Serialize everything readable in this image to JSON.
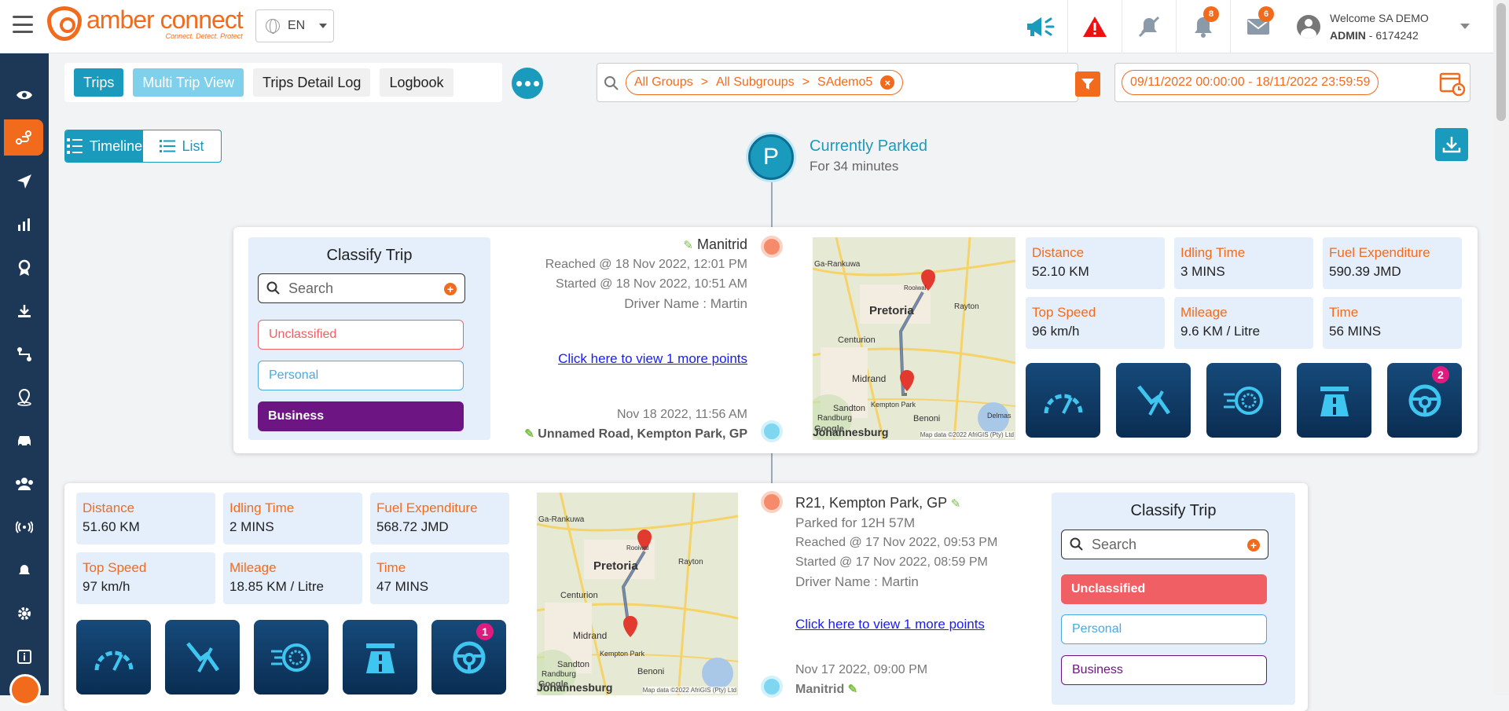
{
  "header": {
    "logo_name": "amber connect",
    "logo_tagline": "Connect. Detect. Protect",
    "language": "EN",
    "notifications_count": "8",
    "messages_count": "6",
    "welcome": "Welcome SA DEMO",
    "account_role": "ADMIN",
    "account_id": " - 6174242"
  },
  "tabs": [
    {
      "label": "Trips"
    },
    {
      "label": "Multi Trip View"
    },
    {
      "label": "Trips Detail Log"
    },
    {
      "label": "Logbook"
    }
  ],
  "filter": {
    "groups": "All Groups",
    "subgroups": "All Subgroups",
    "vehicle": "SAdemo5",
    "separator": ">",
    "date_range": "09/11/2022 00:00:00 - 18/11/2022 23:59:59"
  },
  "view_toggle": {
    "timeline": "Timeline",
    "list": "List"
  },
  "current_status": {
    "icon_letter": "P",
    "title": "Currently Parked",
    "duration": "For 34 minutes"
  },
  "classify": {
    "title": "Classify Trip",
    "search_placeholder": "Search",
    "options": [
      "Unclassified",
      "Personal",
      "Business"
    ]
  },
  "trips": [
    {
      "end_location": "Manitrid",
      "reached": "Reached @ 18 Nov 2022, 12:01 PM",
      "started": "Started @ 18 Nov 2022, 10:51 AM",
      "driver": "Driver Name : Martin",
      "more_points_link": "Click here to view 1 more points",
      "start_time": "Nov 18 2022, 11:56 AM",
      "start_location": "Unnamed Road, Kempton Park, GP",
      "selected_class": "Business",
      "stats": [
        {
          "label": "Distance",
          "value": "52.10 KM"
        },
        {
          "label": "Idling Time",
          "value": "3 MINS"
        },
        {
          "label": "Fuel Expenditure",
          "value": "590.39 JMD"
        },
        {
          "label": "Top Speed",
          "value": "96 km/h"
        },
        {
          "label": "Mileage",
          "value": "9.6 KM / Litre"
        },
        {
          "label": "Time",
          "value": "56 MINS"
        }
      ],
      "driving_alerts_badge": "2"
    },
    {
      "end_location": "R21, Kempton Park, GP",
      "parked": "Parked for 12H 57M",
      "reached": "Reached @ 17 Nov 2022, 09:53 PM",
      "started": "Started @ 17 Nov 2022, 08:59 PM",
      "driver": "Driver Name : Martin",
      "more_points_link": "Click here to view 1 more points",
      "start_time": "Nov 17 2022, 09:00 PM",
      "start_location": "Manitrid",
      "selected_class": "Unclassified",
      "stats": [
        {
          "label": "Distance",
          "value": "51.60 KM"
        },
        {
          "label": "Idling Time",
          "value": "2 MINS"
        },
        {
          "label": "Fuel Expenditure",
          "value": "568.72 JMD"
        },
        {
          "label": "Top Speed",
          "value": "97 km/h"
        },
        {
          "label": "Mileage",
          "value": "18.85 KM / Litre"
        },
        {
          "label": "Time",
          "value": "47 MINS"
        }
      ],
      "driving_alerts_badge": "1"
    }
  ],
  "map": {
    "labels": [
      "Ga-Rankuwa",
      "Pretoria",
      "Rayton",
      "Centurion",
      "Midrand",
      "Kempton Park",
      "Sandton",
      "Randburg",
      "Benoni",
      "Delmas",
      "Johannesburg",
      "Rooiwal"
    ],
    "attribution": "Map data ©2022 AfriGIS (Pty) Ltd",
    "google": "Google"
  },
  "colors": {
    "accent": "#f26b1d",
    "primary": "#1a9bbd",
    "sidebar": "#1d3757",
    "business": "#6d1582",
    "unclassified": "#ef5f63"
  }
}
